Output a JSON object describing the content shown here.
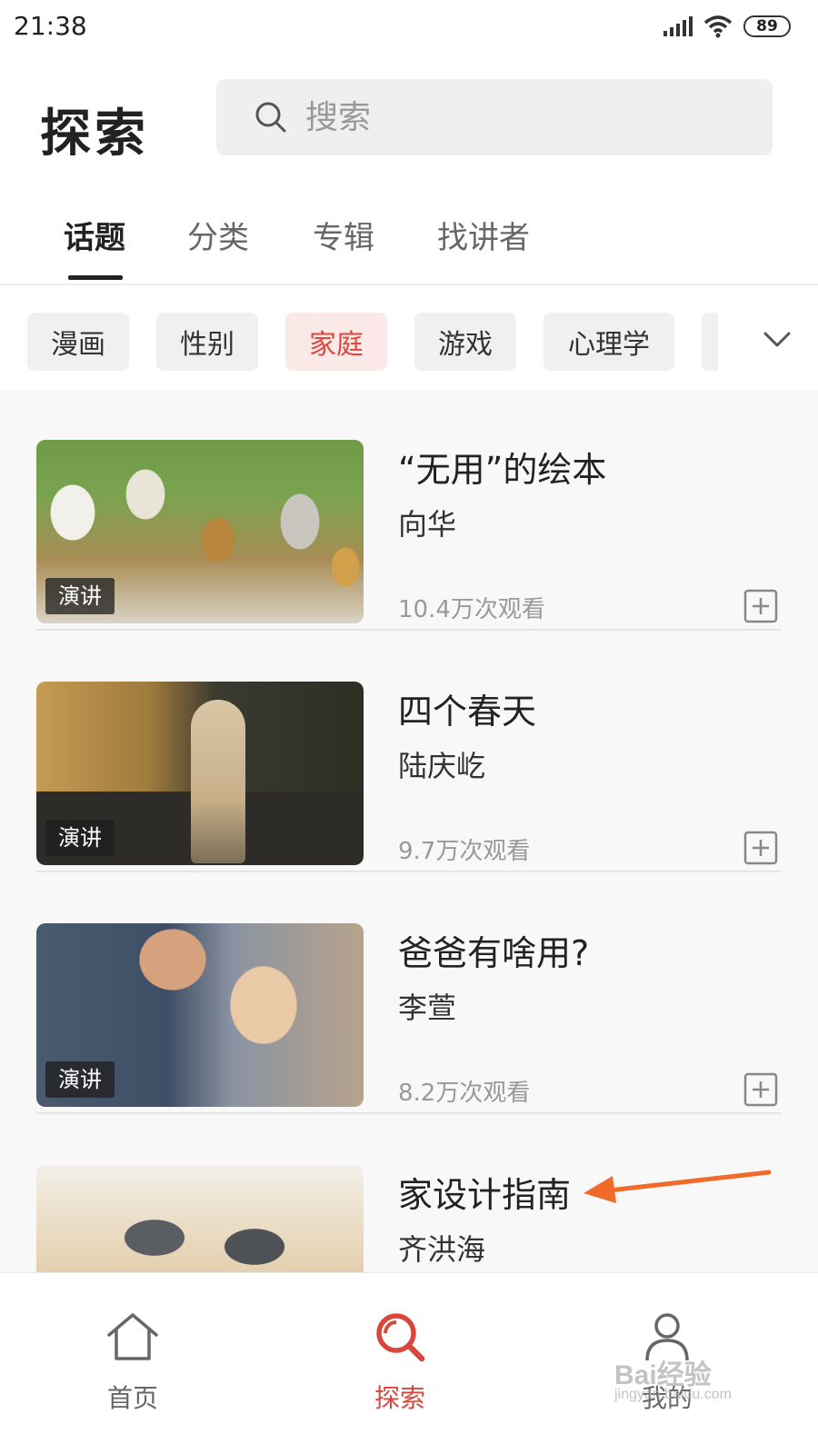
{
  "status_bar": {
    "time": "21:38",
    "battery": "89"
  },
  "header": {
    "title": "探索",
    "search_placeholder": "搜索"
  },
  "tabs": [
    {
      "label": "话题",
      "active": true
    },
    {
      "label": "分类",
      "active": false
    },
    {
      "label": "专辑",
      "active": false
    },
    {
      "label": "找讲者",
      "active": false
    }
  ],
  "chips": [
    {
      "label": "漫画",
      "selected": false
    },
    {
      "label": "性别",
      "selected": false
    },
    {
      "label": "家庭",
      "selected": true
    },
    {
      "label": "游戏",
      "selected": false
    },
    {
      "label": "心理学",
      "selected": false
    }
  ],
  "cards": [
    {
      "title": "“无用”的绘本",
      "speaker": "向华",
      "views": "10.4万次观看",
      "badge": "演讲"
    },
    {
      "title": "四个春天",
      "speaker": "陆庆屹",
      "views": "9.7万次观看",
      "badge": "演讲"
    },
    {
      "title": "爸爸有啥用?",
      "speaker": "李萱",
      "views": "8.2万次观看",
      "badge": "演讲"
    },
    {
      "title": "家设计指南",
      "speaker": "齐洪海",
      "views": "",
      "badge": ""
    }
  ],
  "bottom_nav": [
    {
      "label": "首页",
      "icon": "home-icon",
      "active": false
    },
    {
      "label": "探索",
      "icon": "search-icon",
      "active": true
    },
    {
      "label": "我的",
      "icon": "user-icon",
      "active": false
    }
  ],
  "watermark": {
    "text": "Bai经验",
    "sub": "jingyan.baidu.com"
  },
  "colors": {
    "accent": "#d9473c",
    "chip_selected_bg": "#fbe9e8",
    "arrow": "#f06a2a"
  }
}
